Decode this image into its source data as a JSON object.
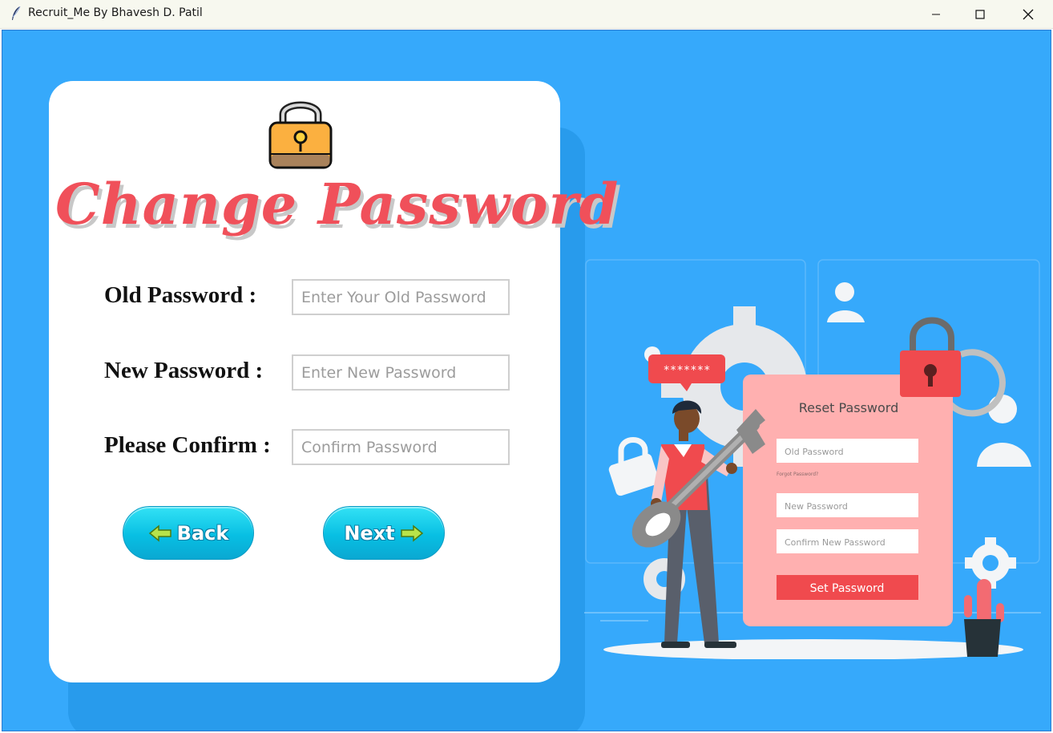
{
  "window": {
    "title": "Recruit_Me By Bhavesh D. Patil",
    "controls": [
      "minimize-icon",
      "maximize-icon",
      "close-icon"
    ]
  },
  "card": {
    "title": "Change Password",
    "icon": "padlock-icon"
  },
  "form": {
    "old_password": {
      "label": "Old Password :",
      "placeholder": "Enter Your Old Password",
      "value": ""
    },
    "new_password": {
      "label": "New Password :",
      "placeholder": "Enter New Password",
      "value": ""
    },
    "confirm_password": {
      "label": "Please Confirm :",
      "placeholder": "Confirm Password",
      "value": ""
    }
  },
  "buttons": {
    "back": {
      "label": "Back",
      "icon": "arrow-left-icon"
    },
    "next": {
      "label": "Next",
      "icon": "arrow-right-icon"
    }
  },
  "illustration": {
    "bubble_text": "*******",
    "panel_title": "Reset Password",
    "old_password_placeholder": "Old Password",
    "forgot_link": "Forgot Password?",
    "new_password_placeholder": "New Password",
    "confirm_placeholder": "Confirm New Password",
    "set_button": "Set Password"
  },
  "colors": {
    "background": "#36a9fb",
    "title_red": "#f0505a",
    "button_cyan": "#08bfe3",
    "illustration_pink": "#ffb0b0",
    "illustration_red": "#f04a4e"
  }
}
